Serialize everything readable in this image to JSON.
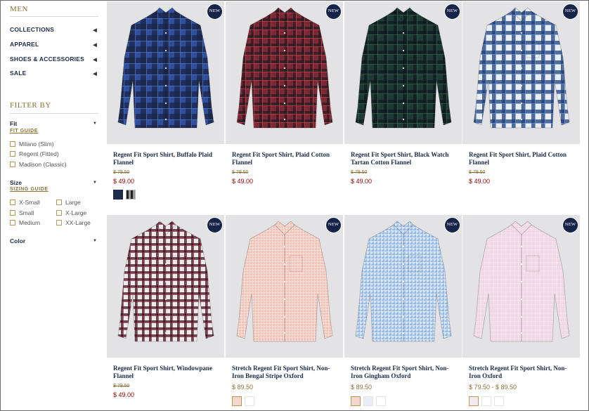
{
  "sidebar": {
    "title": "MEN",
    "nav": [
      {
        "label": "COLLECTIONS"
      },
      {
        "label": "APPAREL"
      },
      {
        "label": "SHOES & ACCESSORIES"
      },
      {
        "label": "SALE"
      }
    ],
    "filter_title": "FILTER BY",
    "fit": {
      "label": "Fit",
      "guide": "FIT GUIDE",
      "options": [
        "Milano (Slim)",
        "Regent (Fitted)",
        "Madison (Classic)"
      ]
    },
    "size": {
      "label": "Size",
      "guide": "SIZING GUIDE",
      "options_left": [
        "X-Small",
        "Small",
        "Medium"
      ],
      "options_right": [
        "Large",
        "X-Large",
        "XX-Large"
      ]
    },
    "color": {
      "label": "Color"
    }
  },
  "badge_text": "NEW",
  "products": [
    {
      "name": "Regent Fit Sport Shirt, Buffalo Plaid Flannel",
      "was": "$ 79.50",
      "price": "$ 49.00",
      "sale": true,
      "pattern": "buffalo-blue",
      "swatches": [
        "#1f2b4c",
        "#3a3a3a"
      ]
    },
    {
      "name": "Regent Fit Sport Shirt, Plaid Cotton Flannel",
      "was": "$ 79.50",
      "price": "$ 49.00",
      "sale": true,
      "pattern": "red-plaid",
      "swatches": []
    },
    {
      "name": "Regent Fit Sport Shirt, Black Watch Tartan Cotton Flannel",
      "was": "$ 79.50",
      "price": "$ 49.00",
      "sale": true,
      "pattern": "black-watch",
      "swatches": []
    },
    {
      "name": "Regent Fit Sport Shirt, Plaid Cotton Flannel",
      "was": "$ 79.50",
      "price": "$ 49.00",
      "sale": true,
      "pattern": "blue-white-plaid",
      "swatches": []
    },
    {
      "name": "Regent Fit Sport Shirt, Windowpane Flannel",
      "was": "$ 79.50",
      "price": "$ 49.00",
      "sale": true,
      "pattern": "windowpane",
      "swatches": []
    },
    {
      "name": "Stretch Regent Fit Sport Shirt, Non-Iron Bengal Stripe Oxford",
      "was": "",
      "price": "$ 89.50",
      "sale": false,
      "pattern": "pink-stripe",
      "swatches": [
        "#f4d6cc",
        "#ffffff"
      ]
    },
    {
      "name": "Stretch Regent Fit Sport Shirt, Non-Iron Gingham Oxford",
      "was": "",
      "price": "$ 89.50",
      "sale": false,
      "pattern": "blue-gingham",
      "swatches": [
        "#f4d6cc",
        "#e9eef6",
        "#ffffff"
      ]
    },
    {
      "name": "Stretch Regent Fit Sport Shirt, Non-Iron Oxford",
      "was": "",
      "price": "$ 79.50 - $ 89.50",
      "sale": false,
      "pattern": "lilac-oxford",
      "swatches": [
        "#f3e9ef",
        "#ffffff",
        "#ffffff"
      ]
    }
  ],
  "colors": {
    "navy": "#1c2a4a",
    "gold": "#8a7136",
    "sale_red": "#8b0000",
    "badge": "#17244a"
  }
}
